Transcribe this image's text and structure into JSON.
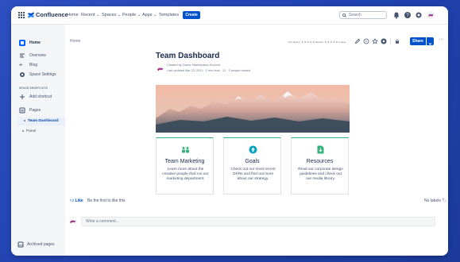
{
  "app": {
    "name": "Confluence"
  },
  "topnav": {
    "items": [
      "Home",
      "Recent",
      "Spaces",
      "People",
      "Apps",
      "Templates"
    ],
    "create_label": "Create",
    "search_placeholder": "Search"
  },
  "sidebar": {
    "items": [
      {
        "label": "Home",
        "icon": "space-icon"
      },
      {
        "label": "Overview",
        "icon": "overview-icon"
      },
      {
        "label": "Blog",
        "icon": "quote-icon"
      },
      {
        "label": "Space Settings",
        "icon": "gear-icon"
      }
    ],
    "shortcuts_title": "SPACE SHORTCUTS",
    "add_shortcut": "Add shortcut",
    "pages_label": "Pages",
    "tree": [
      "Team Dashboard",
      "Panel"
    ],
    "archived": "Archived pages"
  },
  "page": {
    "breadcrumb": "Home",
    "rating_text": "Your Rating: ★ ★ ★ ★ ★ Results: ★ ★ ★ ★ ★ 0 rates",
    "share_label": "Share",
    "title": "Team Dashboard",
    "created_by": "Created by Caelor Marketplace Account",
    "last_updated": "Last updated Mar 23, 2021 · 1 min read · 12 · 3 people viewed",
    "cards": [
      {
        "title": "Team Marketing",
        "desc": "Learn more about the creative people that run our marketing department.",
        "icon": "team-icon",
        "color": "#36b37e"
      },
      {
        "title": "Goals",
        "desc": "Check out our most recent OKRs and find out more about our strategy.",
        "icon": "upload-icon",
        "color": "#00a3bf"
      },
      {
        "title": "Resources",
        "desc": "Read our corporate design guidelines and check out our media library.",
        "icon": "download-doc-icon",
        "color": "#36b37e"
      }
    ],
    "like_label": "Like",
    "be_first": "Be the first to like this",
    "no_labels": "No labels",
    "comment_placeholder": "Write a comment..."
  },
  "colors": {
    "accent": "#0052cc",
    "green": "#36b37e",
    "teal": "#00a3bf",
    "background": "#2143b0"
  }
}
